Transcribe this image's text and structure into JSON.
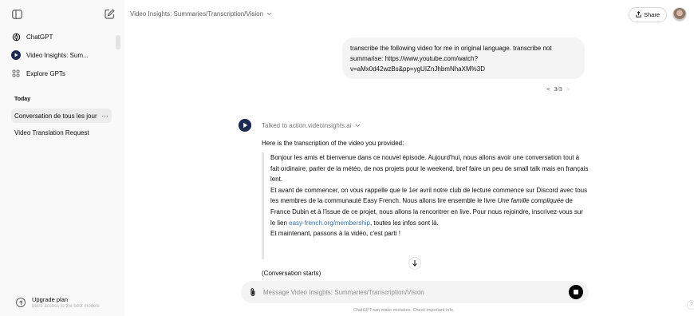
{
  "sidebar": {
    "items": [
      {
        "label": "ChatGPT",
        "icon": "openai-logo-icon"
      },
      {
        "label": "Video Insights: Sum...",
        "icon": "video-insights-logo-icon"
      },
      {
        "label": "Explore GPTs",
        "icon": "grid-icon"
      }
    ],
    "section_label": "Today",
    "conversations": [
      {
        "label": "Conversation de tous les jour",
        "active": true,
        "more": "···"
      },
      {
        "label": "Video Translation Request",
        "active": false
      }
    ],
    "upgrade": {
      "title": "Upgrade plan",
      "subtitle": "More access to the best models"
    }
  },
  "header": {
    "title": "Video Insights: Summaries/Transcription/Vision",
    "share_label": "Share"
  },
  "chat": {
    "user_message": "transcribe the following video for me in original language. transcribe not summarise: https://www.youtube.com/watch?v=aMx0d42wzBs&pp=ygUIZnJhbmNhaXM%3D",
    "pager": {
      "label": "3/3",
      "prev": "<",
      "next": ">"
    },
    "talked_to": "Talked to action.videoinsights.ai",
    "intro": "Here is the transcription of the video you provided:",
    "quote": {
      "p1": "Bonjour les amis et bienvenue dans ce nouvel épisode. Aujourd'hui, nous allons avoir une conversation tout à fait ordinaire, parler de la météo, de nos projets pour le weekend, bref faire un peu de small talk mais en français lent.",
      "p2a": "Et avant de commencer, on vous rappelle que le 1er avril notre club de lecture commence sur Discord avec tous les membres de la communauté Easy French. Nous allons lire ensemble le livre ",
      "p2_italic": "Une famille compliquée",
      "p2b": " de France Dubin et à l'issue de ce projet, nous allons la rencontrer en live. Pour nous rejoindre, inscrivez-vous sur le lien ",
      "p2_link": "easy-french.org/membership",
      "p2c": ", toutes les infos sont là.",
      "p3": "Et maintenant, passons à la vidéo, c'est parti !"
    },
    "conversation_starts": "(Conversation starts)"
  },
  "composer": {
    "placeholder": "Message Video Insights: Summaries/Transcription/Vision",
    "value": ""
  },
  "footer": {
    "disclaimer": "ChatGPT can make mistakes. Check important info.",
    "help": "?"
  },
  "colors": {
    "sidebar_bg": "#f9f9f9",
    "bubble_bg": "#f4f4f4",
    "link": "#3a6ea5",
    "bot_avatar": "#1d2b53"
  }
}
